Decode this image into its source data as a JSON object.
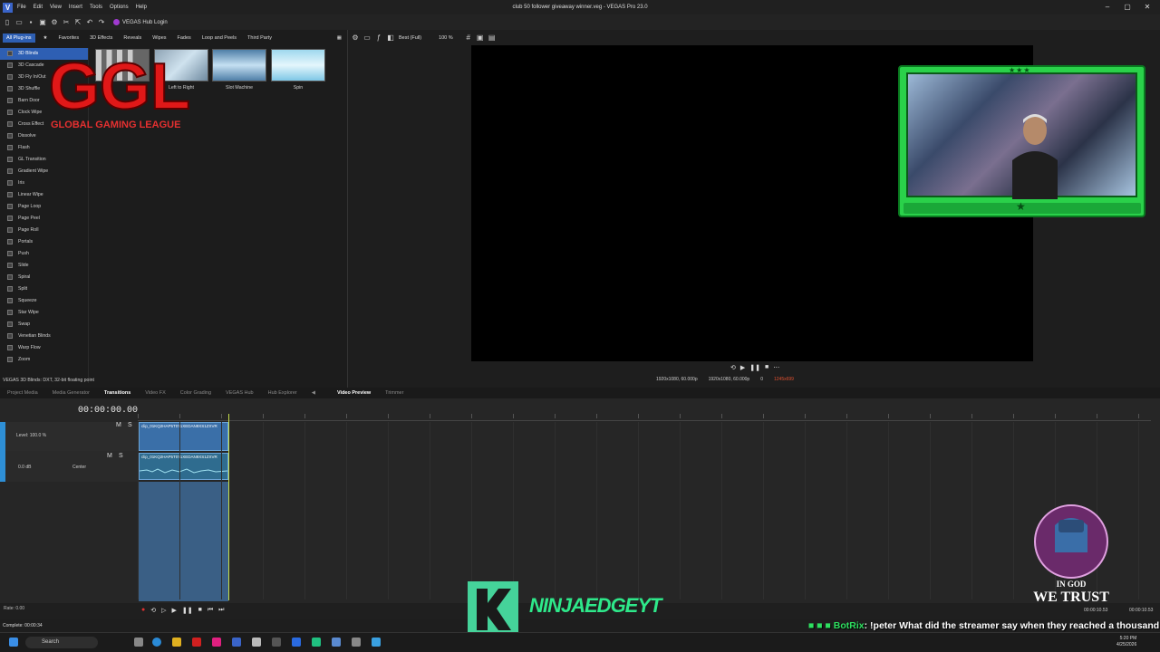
{
  "titlebar": {
    "menus": [
      "File",
      "Edit",
      "View",
      "Insert",
      "Tools",
      "Options",
      "Help"
    ],
    "title": "club 50 follower giveaway winner.veg - VEGAS Pro 23.0",
    "hub_login": "VEGAS Hub Login"
  },
  "plugin_tabs": [
    "All Plug-ins",
    "Favorites",
    "3D Effects",
    "Reveals",
    "Wipes",
    "Fades",
    "Loop and Peels",
    "Third Party"
  ],
  "plugin_tree": [
    "3D Blinds",
    "3D Cascade",
    "3D Fly In/Out",
    "3D Shuffle",
    "Barn Door",
    "Clock Wipe",
    "Cross Effect",
    "Dissolve",
    "Flash",
    "GL Transition",
    "Gradient Wipe",
    "Iris",
    "Linear Wipe",
    "Page Loop",
    "Page Peel",
    "Page Roll",
    "Portals",
    "Push",
    "Slide",
    "Spiral",
    "Split",
    "Squeeze",
    "Star Wipe",
    "Swap",
    "Venetian Blinds",
    "Warp Flow",
    "Zoom"
  ],
  "thumbnails": [
    "Left to Right",
    "Slot Machine",
    "Spin"
  ],
  "status_line": "VEGAS 3D Blinds: DXT, 32-bit floating point",
  "logo": {
    "letters": "GGL",
    "subtitle": "GLOBAL GAMING LEAGUE"
  },
  "preview": {
    "quality": "Best (Full)",
    "zoom": "100 %",
    "project_res": "1920x1080, 60.000p",
    "preview_res": "1920x1080, 60.000p",
    "frame": "0",
    "display": "1245x699"
  },
  "bottom_tabs": [
    "Project Media",
    "Media Generator",
    "Transitions",
    "Video FX",
    "Color Grading",
    "VEGAS Hub",
    "Hub Explorer"
  ],
  "preview_tabs": [
    "Video Preview",
    "Trimmer"
  ],
  "timeline": {
    "timecode": "00:00:00.00",
    "level": "Level: 100.0 %",
    "audio_db": "0.0 dB",
    "pan": "Center",
    "clip_name": "clip_01KQ2HAP5T071XEDAN9XS1ZXVR",
    "rate": "Rate: 0.00",
    "end_time1": "00:00:10.53",
    "end_time2": "00:00:10.53",
    "start_time": "00:00:..."
  },
  "complete": "Complete: 00:00:34",
  "overlay": {
    "ninja_name": "NINJAEDGEYT",
    "badge": "IN GOD WE TRUST"
  },
  "chat": {
    "user": "BotRix",
    "message": ": !peter What did the streamer say when they reached a thousand followers? \"It's a stream-come true!\""
  },
  "taskbar": {
    "search": "Search",
    "time": "5:20 PM",
    "date": "4/25/2026"
  }
}
